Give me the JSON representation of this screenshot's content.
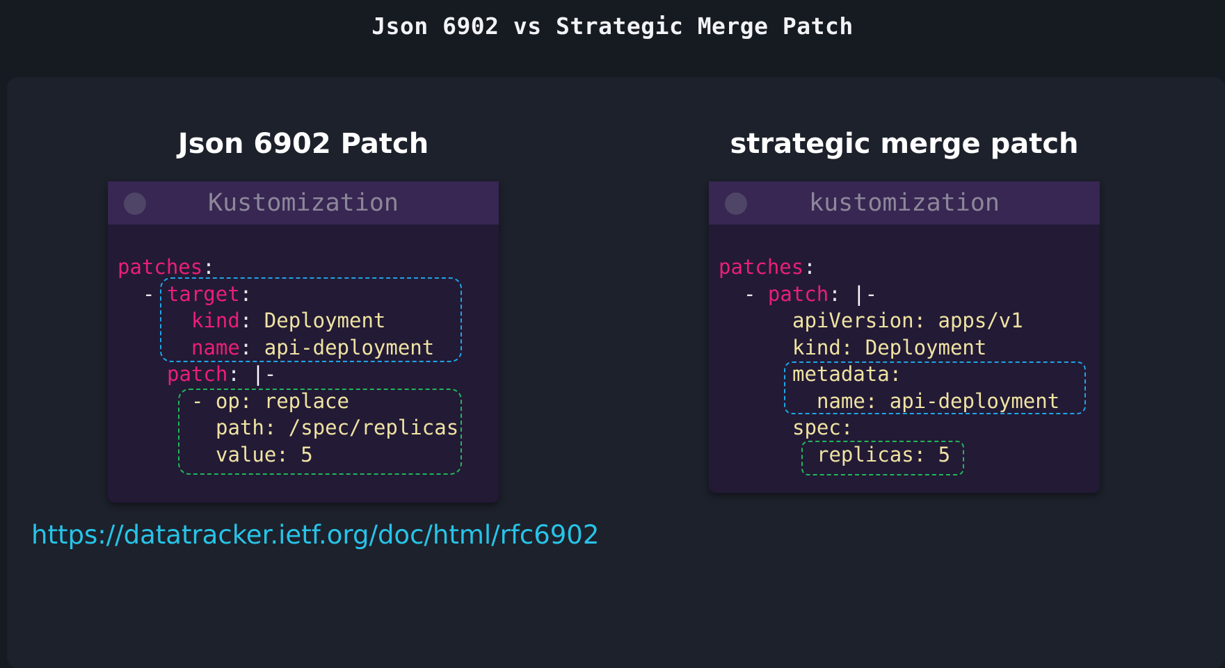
{
  "title": "Json 6902 vs Strategic Merge Patch",
  "left": {
    "heading": "Json 6902 Patch",
    "card_title": "Kustomization",
    "code": {
      "patches_key": "patches",
      "colon": ":",
      "dash": "- ",
      "target_key": "target",
      "kind_key": "kind",
      "kind_value": " Deployment",
      "name_key": "name",
      "name_value": " api-deployment",
      "patch_key": "patch",
      "patch_sep": ": ",
      "cursor": "|",
      "block_indicator": "-",
      "op_line": "- op: replace",
      "path_line": "path: /spec/replicas",
      "value_line": "value: 5"
    }
  },
  "right": {
    "heading": "strategic merge patch",
    "card_title": "kustomization",
    "code": {
      "patches_key": "patches",
      "colon": ":",
      "dash": "- ",
      "patch_key": "patch",
      "patch_sep": ": ",
      "cursor": "|",
      "block_indicator": "-",
      "api_line": "apiVersion: apps/v1",
      "kind_line": "kind: Deployment",
      "metadata_line": "metadata:",
      "name_line": "name: api-deployment",
      "spec_line": "spec:",
      "replicas_line": "replicas: 5"
    }
  },
  "link": {
    "text": "https://datatracker.ietf.org/doc/html/rfc6902"
  },
  "colors": {
    "key": "#ea1f78",
    "string": "#efe3a2",
    "blue_box": "#1ea6e6",
    "green_box": "#21b857",
    "link": "#27c4e8"
  }
}
